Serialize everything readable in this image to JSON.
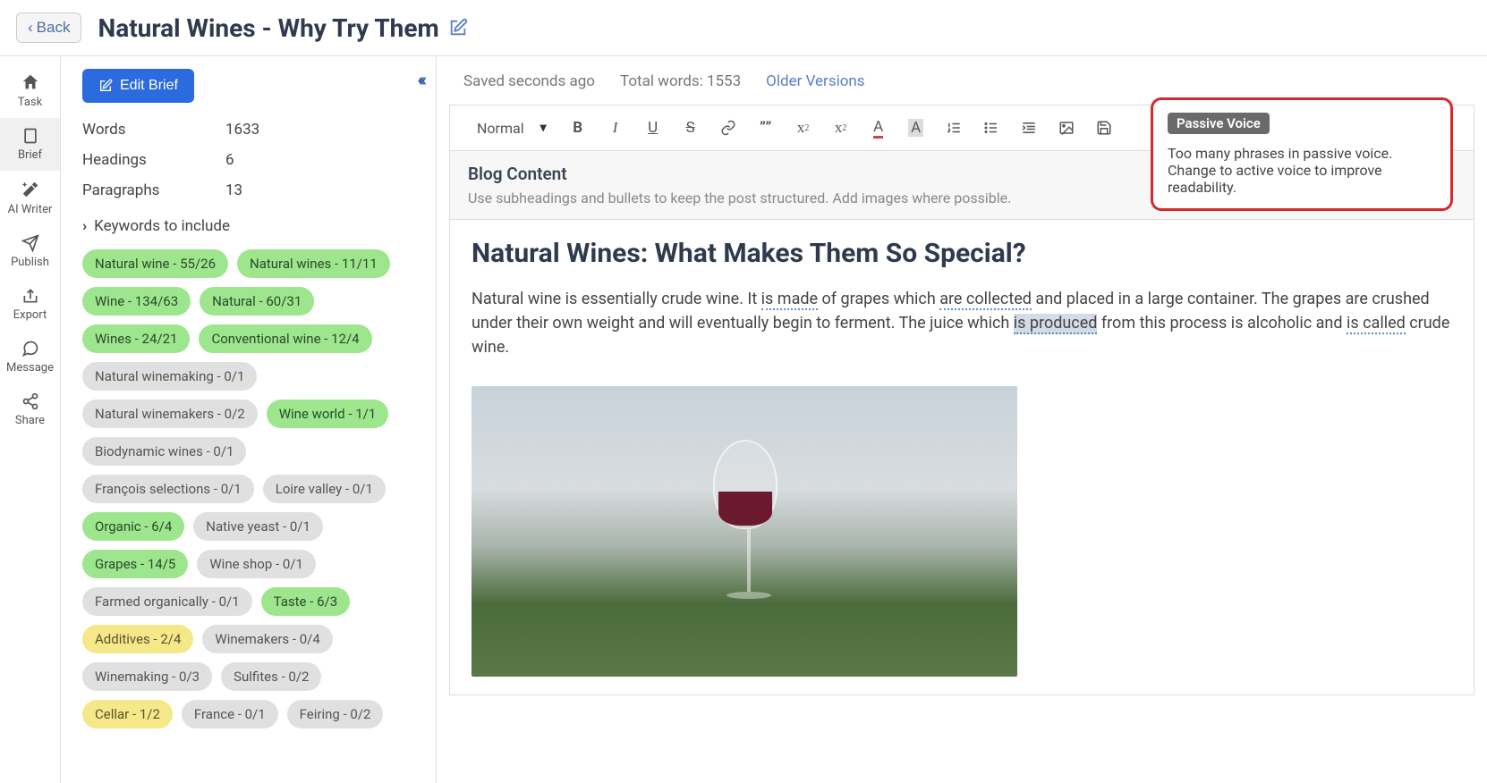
{
  "header": {
    "back_label": "Back",
    "title": "Natural Wines - Why Try Them"
  },
  "nav": {
    "items": [
      {
        "label": "Task",
        "icon": "home"
      },
      {
        "label": "Brief",
        "icon": "doc"
      },
      {
        "label": "AI Writer",
        "icon": "wand"
      },
      {
        "label": "Publish",
        "icon": "send"
      },
      {
        "label": "Export",
        "icon": "export"
      },
      {
        "label": "Message",
        "icon": "chat"
      },
      {
        "label": "Share",
        "icon": "share"
      }
    ]
  },
  "brief": {
    "edit_btn": "Edit Brief",
    "stats": {
      "words_label": "Words",
      "words_value": "1633",
      "headings_label": "Headings",
      "headings_value": "6",
      "paragraphs_label": "Paragraphs",
      "paragraphs_value": "13"
    },
    "keywords_header": "Keywords to include",
    "tags": [
      {
        "label": "Natural wine - 55/26",
        "style": "green"
      },
      {
        "label": "Natural wines - 11/11",
        "style": "green"
      },
      {
        "label": "Wine - 134/63",
        "style": "green"
      },
      {
        "label": "Natural - 60/31",
        "style": "green"
      },
      {
        "label": "Wines - 24/21",
        "style": "green"
      },
      {
        "label": "Conventional wine - 12/4",
        "style": "green"
      },
      {
        "label": "Natural winemaking - 0/1",
        "style": "gray"
      },
      {
        "label": "Natural winemakers - 0/2",
        "style": "gray"
      },
      {
        "label": "Wine world - 1/1",
        "style": "green"
      },
      {
        "label": "Biodynamic wines - 0/1",
        "style": "gray"
      },
      {
        "label": "François selections - 0/1",
        "style": "gray"
      },
      {
        "label": "Loire valley - 0/1",
        "style": "gray"
      },
      {
        "label": "Organic - 6/4",
        "style": "green"
      },
      {
        "label": "Native yeast - 0/1",
        "style": "gray"
      },
      {
        "label": "Grapes - 14/5",
        "style": "green"
      },
      {
        "label": "Wine shop - 0/1",
        "style": "gray"
      },
      {
        "label": "Farmed organically - 0/1",
        "style": "gray"
      },
      {
        "label": "Taste - 6/3",
        "style": "green"
      },
      {
        "label": "Additives - 2/4",
        "style": "yellow"
      },
      {
        "label": "Winemakers - 0/4",
        "style": "gray"
      },
      {
        "label": "Winemaking - 0/3",
        "style": "gray"
      },
      {
        "label": "Sulfites - 0/2",
        "style": "gray"
      },
      {
        "label": "Cellar - 1/2",
        "style": "yellow"
      },
      {
        "label": "France - 0/1",
        "style": "gray"
      },
      {
        "label": "Feiring - 0/2",
        "style": "gray"
      }
    ]
  },
  "status": {
    "saved": "Saved seconds ago",
    "total_words_label": "Total words:",
    "total_words_value": "1553",
    "older_versions": "Older Versions"
  },
  "toolbar": {
    "format_value": "Normal"
  },
  "section": {
    "title": "Blog Content",
    "sub": "Use subheadings and bullets to keep the post structured. Add images where possible."
  },
  "article": {
    "h1": "Natural Wines: What Makes Them So Special?",
    "p1_a": "Natural wine is essentially crude wine. It ",
    "p1_passive1": "is made",
    "p1_b": " of grapes which ",
    "p1_passive2": "are collected",
    "p1_c": " and placed in a large container. The grapes are crushed under their own weight and will eventually begin to ferment. The juice which ",
    "p1_passive3": "is produced",
    "p1_d": " from this process is alcoholic and ",
    "p1_passive4": "is called",
    "p1_e": " crude wine."
  },
  "tip": {
    "badge": "Passive Voice",
    "text": "Too many phrases in passive voice. Change to active voice to improve readability."
  }
}
